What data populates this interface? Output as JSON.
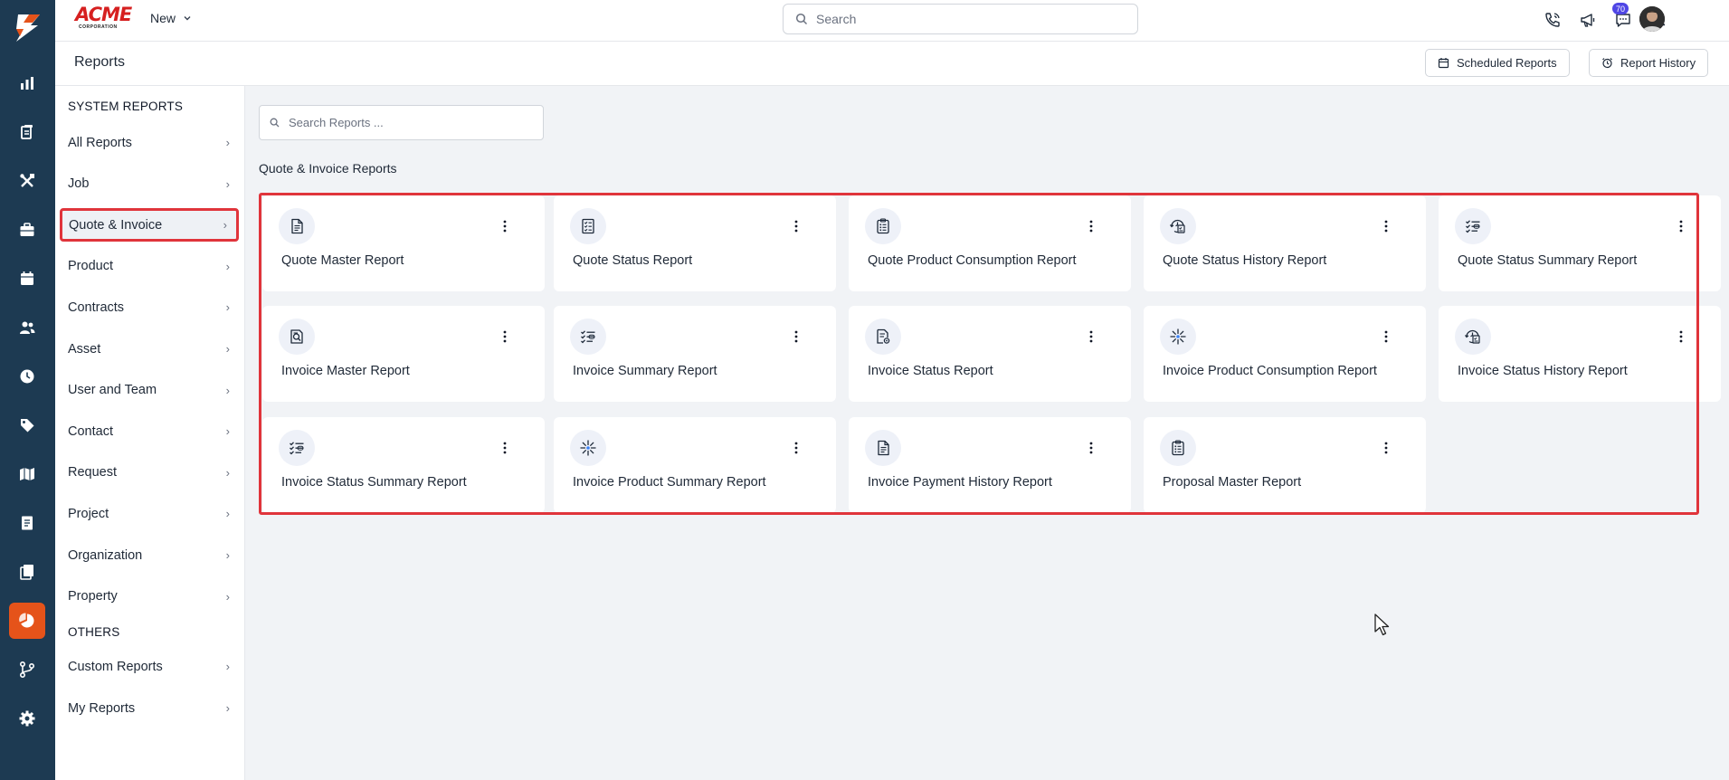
{
  "rail": {
    "items": [
      {
        "name": "dashboard-icon"
      },
      {
        "name": "clipboard-icon"
      },
      {
        "name": "tools-icon"
      },
      {
        "name": "briefcase-icon"
      },
      {
        "name": "calendar-icon"
      },
      {
        "name": "users-icon"
      },
      {
        "name": "clock-icon"
      },
      {
        "name": "tag-icon"
      },
      {
        "name": "map-icon"
      },
      {
        "name": "invoice-icon"
      },
      {
        "name": "documents-icon"
      },
      {
        "name": "reports-icon",
        "active": true
      },
      {
        "name": "workflow-icon"
      },
      {
        "name": "settings-icon"
      }
    ]
  },
  "header": {
    "brand": "ACME",
    "brand_sub": "CORPORATION",
    "new_label": "New",
    "search_placeholder": "Search",
    "notification_count": "70"
  },
  "titlebar": {
    "title": "Reports",
    "scheduled_label": "Scheduled Reports",
    "history_label": "Report History"
  },
  "sidebar": {
    "system_heading": "SYSTEM REPORTS",
    "system_items": [
      {
        "label": "All Reports"
      },
      {
        "label": "Job"
      },
      {
        "label": "Quote & Invoice",
        "active": true
      },
      {
        "label": "Product"
      },
      {
        "label": "Contracts"
      },
      {
        "label": "Asset"
      },
      {
        "label": "User and Team"
      },
      {
        "label": "Contact"
      },
      {
        "label": "Request"
      },
      {
        "label": "Project"
      },
      {
        "label": "Organization"
      },
      {
        "label": "Property"
      }
    ],
    "others_heading": "OTHERS",
    "other_items": [
      {
        "label": "Custom Reports"
      },
      {
        "label": "My Reports"
      }
    ]
  },
  "main": {
    "search_placeholder": "Search Reports ...",
    "section_title": "Quote & Invoice Reports",
    "cards": [
      {
        "title": "Quote Master Report",
        "icon": "document-icon"
      },
      {
        "title": "Quote Status Report",
        "icon": "checklist-icon"
      },
      {
        "title": "Quote Product Consumption Report",
        "icon": "clipboard-list-icon"
      },
      {
        "title": "Quote Status History Report",
        "icon": "status-history-icon"
      },
      {
        "title": "Quote Status Summary Report",
        "icon": "list-check-icon"
      },
      {
        "title": "Invoice Master Report",
        "icon": "search-document-icon"
      },
      {
        "title": "Invoice Summary Report",
        "icon": "list-check-icon"
      },
      {
        "title": "Invoice Status Report",
        "icon": "document-settings-icon"
      },
      {
        "title": "Invoice Product Consumption Report",
        "icon": "sparkle-icon"
      },
      {
        "title": "Invoice Status History Report",
        "icon": "status-history-icon"
      },
      {
        "title": "Invoice Status Summary Report",
        "icon": "list-check-icon"
      },
      {
        "title": "Invoice Product Summary Report",
        "icon": "sparkle-icon"
      },
      {
        "title": "Invoice Payment History Report",
        "icon": "document-icon"
      },
      {
        "title": "Proposal Master Report",
        "icon": "clipboard-list-icon"
      }
    ]
  },
  "colors": {
    "rail": "#1d3a52",
    "accent": "#e5531a",
    "highlight": "#e0343b",
    "icon_stroke": "#1e2a3a"
  }
}
